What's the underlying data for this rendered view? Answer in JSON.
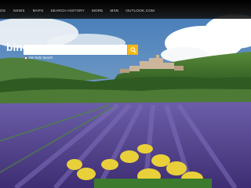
{
  "nav": {
    "items": [
      {
        "label": "OS"
      },
      {
        "label": "NEWS"
      },
      {
        "label": "MAPS"
      },
      {
        "label": "SEARCH HISTORY"
      },
      {
        "label": "MORE"
      },
      {
        "label": "MSN"
      },
      {
        "label": "OUTLOOK.COM"
      }
    ]
  },
  "brand": {
    "logo_text": "bing"
  },
  "search": {
    "value": "",
    "placeholder": "",
    "button_icon": "magnifier-icon",
    "button_color": "#f7b719"
  },
  "safe_search": {
    "label": "Set Safe Search",
    "checked": false
  },
  "background": {
    "sky": "#6b8fb6",
    "cloud": "#ffffff",
    "lavender": "#5b4c9c",
    "flower": "#f0d53c"
  }
}
